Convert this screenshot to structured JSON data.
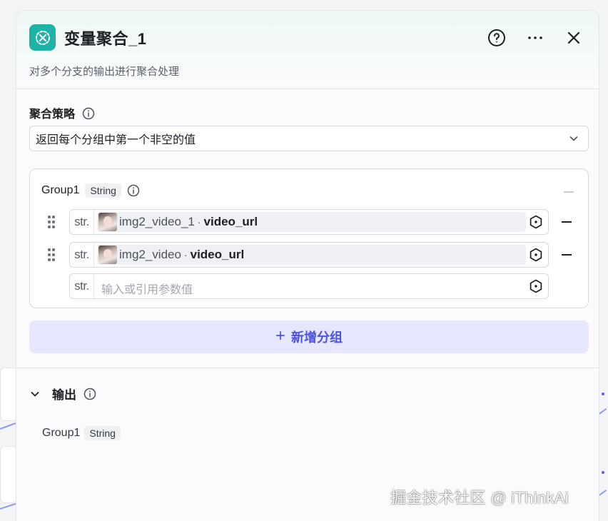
{
  "node": {
    "title": "变量聚合_1",
    "description": "对多个分支的输出进行聚合处理",
    "icon": "variable-merge-icon",
    "accent": "#1eb3a7"
  },
  "header_actions": {
    "help_icon": "help-circle-icon",
    "more_icon": "more-horizontal-icon",
    "close_icon": "close-icon"
  },
  "strategy": {
    "label": "聚合策略",
    "selected": "返回每个分组中第一个非空的值"
  },
  "group": {
    "name": "Group1",
    "type": "String",
    "variables": [
      {
        "prefix": "str.",
        "node": "img2_video_1",
        "separator": "·",
        "field": "video_url"
      },
      {
        "prefix": "str.",
        "node": "img2_video",
        "separator": "·",
        "field": "video_url"
      }
    ],
    "empty_input": {
      "prefix": "str.",
      "placeholder": "输入或引用参数值"
    }
  },
  "add_group": {
    "icon": "+",
    "label": "新增分组"
  },
  "output": {
    "label": "输出",
    "items": [
      {
        "name": "Group1",
        "type": "String"
      }
    ]
  },
  "watermark": "掘金技术社区 @ iThinkAi",
  "colors": {
    "primary": "#4c52e6",
    "add_group_bg": "#e6e7fd",
    "border": "#d6d9e0"
  }
}
